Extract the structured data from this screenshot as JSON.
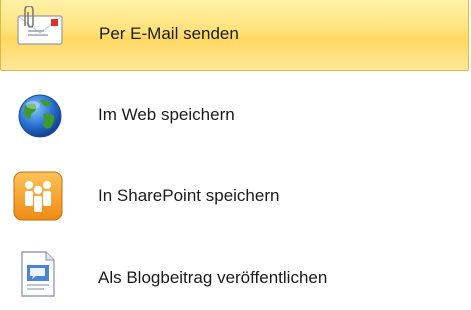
{
  "menu": {
    "items": [
      {
        "label": "Per E-Mail senden",
        "icon": "email-envelope-icon",
        "selected": true
      },
      {
        "label": "Im Web speichern",
        "icon": "globe-icon",
        "selected": false
      },
      {
        "label": "In SharePoint speichern",
        "icon": "sharepoint-icon",
        "selected": false
      },
      {
        "label": "Als Blogbeitrag veröffentlichen",
        "icon": "blog-post-icon",
        "selected": false
      }
    ]
  },
  "colors": {
    "selected_background": "#ffe27a",
    "selected_border": "#e4b742",
    "sharepoint_orange": "#f39a1c",
    "globe_blue": "#2a6fd1",
    "globe_green": "#3e9a2f"
  }
}
